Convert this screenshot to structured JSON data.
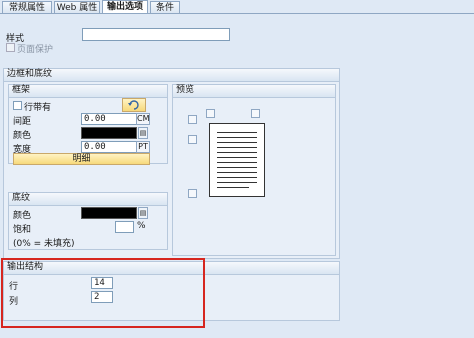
{
  "tabs": [
    {
      "label": "常规属性",
      "active": false
    },
    {
      "label": "Web 属性",
      "active": false
    },
    {
      "label": "输出选项",
      "active": true
    },
    {
      "label": "条件",
      "active": false
    }
  ],
  "style": {
    "label": "样式",
    "value": "",
    "page_protect_label": "页面保护"
  },
  "border_shading": {
    "title": "边框和底纹",
    "frame": {
      "title": "框架",
      "with_lines_label": "行带有",
      "spacing_label": "间距",
      "spacing_value": "0.00",
      "spacing_unit": "CM",
      "color_label": "颜色",
      "color_value": "",
      "width_label": "宽度",
      "width_value": "0.00",
      "width_unit": "PT",
      "clear_button": "明细"
    },
    "preview": {
      "title": "预览"
    },
    "shading": {
      "title": "底纹",
      "color_label": "颜色",
      "saturation_label": "饱和",
      "saturation_value": "",
      "saturation_unit": "%",
      "note": "(0% = 未填充)"
    }
  },
  "output_structure": {
    "title": "输出结构",
    "rows_label": "行",
    "rows_value": "14",
    "cols_label": "列",
    "cols_value": "2"
  },
  "colors": {
    "highlight": "#d6261f",
    "accent_button": "#f7d97b"
  },
  "icons": {
    "refresh": "refresh-icon",
    "picker": "color-picker-icon"
  }
}
